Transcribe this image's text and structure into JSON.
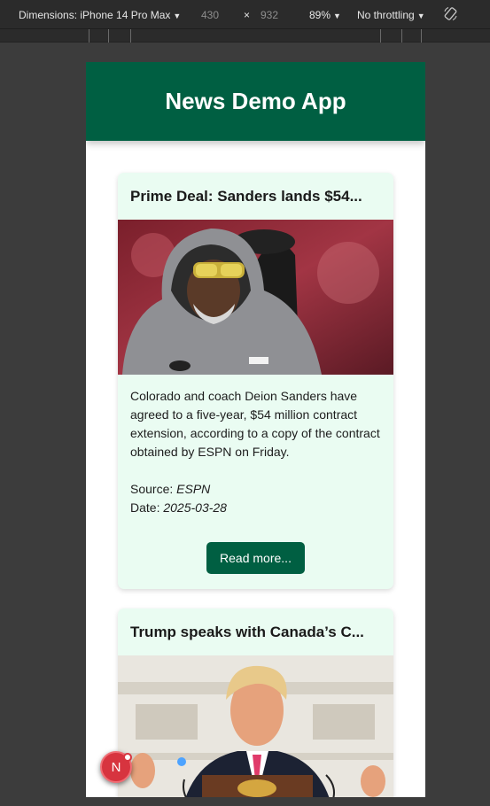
{
  "devtools": {
    "dimensions_label": "Dimensions: iPhone 14 Pro Max",
    "width": "430",
    "times": "×",
    "height": "932",
    "zoom": "89%",
    "throttling": "No throttling"
  },
  "app": {
    "title": "News Demo App"
  },
  "articles": [
    {
      "title": "Prime Deal: Sanders lands $54...",
      "description": "Colorado and coach Deion Sanders have agreed to a five-year, $54 million contract extension, according to a copy of the contract obtained by ESPN on Friday.",
      "source_label": "Source:",
      "source": "ESPN",
      "date_label": "Date:",
      "date": "2025-03-28",
      "read_more": "Read more..."
    },
    {
      "title": "Trump speaks with Canada’s C..."
    }
  ],
  "badge": {
    "letter": "N"
  },
  "colors": {
    "header": "#005f42",
    "card": "#eafcf2",
    "button": "#005f42",
    "badge": "#d7343f"
  }
}
